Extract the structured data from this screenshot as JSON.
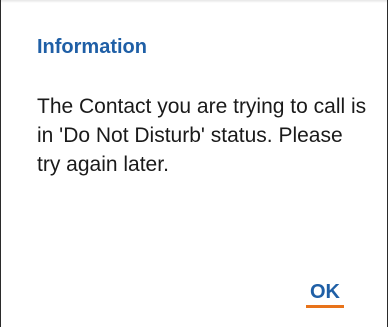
{
  "dialog": {
    "title": "Information",
    "message": "The Contact you are trying to call is in 'Do Not Disturb' status. Please try again later.",
    "ok_label": "OK"
  },
  "colors": {
    "title": "#1f5fa6",
    "text": "#1a1a1a",
    "accent": "#e8731a",
    "background": "#ffffff"
  }
}
